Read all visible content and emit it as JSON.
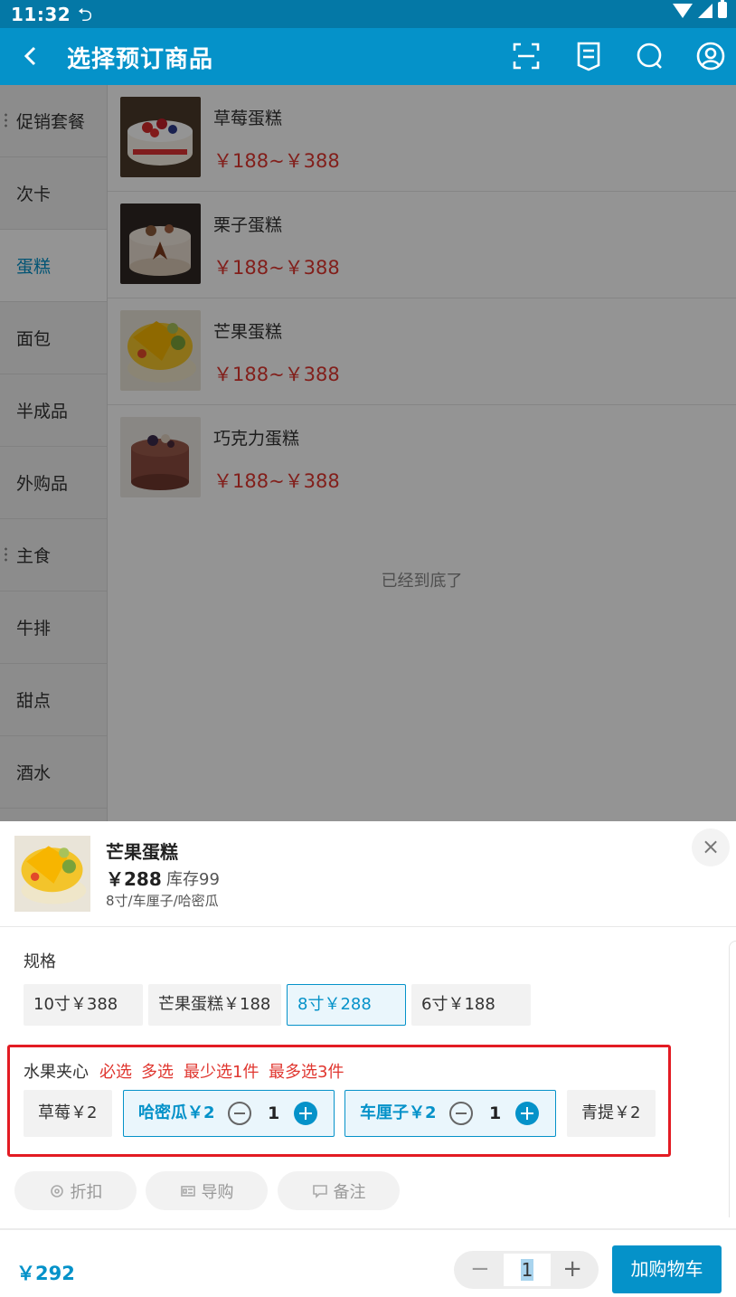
{
  "status": {
    "time": "11:32"
  },
  "header": {
    "title": "选择预订商品"
  },
  "sidebar": {
    "items": [
      {
        "label": "促销套餐"
      },
      {
        "label": "次卡"
      },
      {
        "label": "蛋糕"
      },
      {
        "label": "面包"
      },
      {
        "label": "半成品"
      },
      {
        "label": "外购品"
      },
      {
        "label": "主食"
      },
      {
        "label": "牛排"
      },
      {
        "label": "甜点"
      },
      {
        "label": "酒水"
      }
    ],
    "active_label": "蛋糕"
  },
  "products": [
    {
      "name": "草莓蛋糕",
      "price": "￥188~￥388"
    },
    {
      "name": "栗子蛋糕",
      "price": "￥188~￥388"
    },
    {
      "name": "芒果蛋糕",
      "price": "￥188~￥388"
    },
    {
      "name": "巧克力蛋糕",
      "price": "￥188~￥388"
    }
  ],
  "list_end_text": "已经到底了",
  "sheet": {
    "name": "芒果蛋糕",
    "price": "￥288",
    "stock": "库存99",
    "selection": "8寸/车厘子/哈密瓜",
    "close": "×",
    "spec_label": "规格",
    "specs": [
      "10寸￥388",
      "芒果蛋糕￥188",
      "8寸￥288",
      "6寸￥188"
    ],
    "selected_spec": "8寸￥288",
    "fruit_label": "水果夹心",
    "fruit_tags": [
      "必选",
      "多选",
      "最少选1件",
      "最多选3件"
    ],
    "fruits": [
      {
        "label": "草莓￥2"
      },
      {
        "label": "哈密瓜￥2",
        "qty": "1"
      },
      {
        "label": "车厘子￥2",
        "qty": "1"
      },
      {
        "label": "青提￥2"
      }
    ],
    "actions": [
      "折扣",
      "导购",
      "备注"
    ],
    "total": "￥292",
    "quantity": "1",
    "add_to_cart": "加购物车"
  },
  "colors": {
    "primary": "#0592c9",
    "status_bar": "#0478a6",
    "price_red": "#e0362f",
    "highlight_box": "#e31b23"
  }
}
